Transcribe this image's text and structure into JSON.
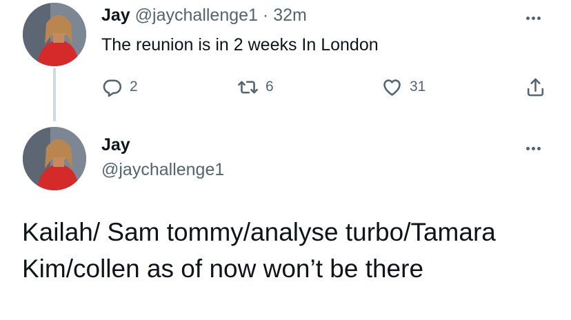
{
  "tweet1": {
    "name": "Jay",
    "handle": "@jaychallenge1",
    "separator": "·",
    "time": "32m",
    "text": "The reunion is in 2 weeks In London",
    "reply_count": "2",
    "retweet_count": "6",
    "like_count": "31"
  },
  "tweet2": {
    "name": "Jay",
    "handle": "@jaychallenge1",
    "text": "Kailah/ Sam tommy/analyse turbo/Tamara Kim/collen as of now won’t be there"
  },
  "icons": {
    "reply": "reply-icon",
    "retweet": "retweet-icon",
    "like": "heart-icon",
    "share": "share-icon",
    "more": "more-options-icon"
  },
  "colors": {
    "text": "#0f1419",
    "secondary": "#536471",
    "thread_line": "#cfd9de"
  }
}
